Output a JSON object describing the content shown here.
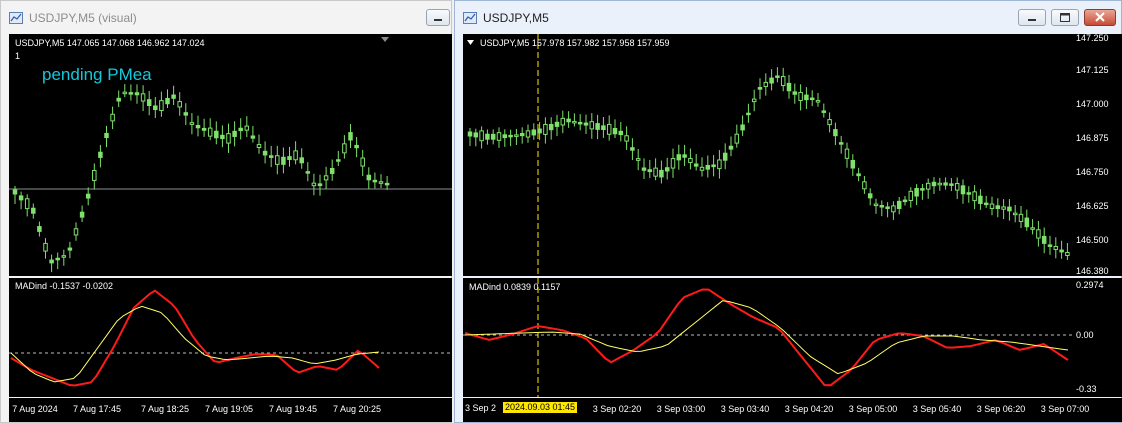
{
  "windows": {
    "left": {
      "title": "USDJPY,M5 (visual)",
      "chart_label": "USDJPY,M5  147.065 147.068 146.962 147.024",
      "sub_label": "1",
      "overlay_text": "pending PMea",
      "indicator_label": "MADind -0.1537 -0.0202",
      "time_axis": [
        "7 Aug 2024",
        "7 Aug 17:45",
        "7 Aug 18:25",
        "7 Aug 19:05",
        "7 Aug 19:45",
        "7 Aug 20:25"
      ]
    },
    "right": {
      "title": "USDJPY,M5",
      "chart_label": "USDJPY,M5  157.978 157.982 157.958 157.959",
      "indicator_label": "MADind 0.0839 0.1157",
      "price_axis": [
        "147.250",
        "147.125",
        "147.000",
        "146.875",
        "146.750",
        "146.625",
        "146.500",
        "146.380"
      ],
      "indicator_axis": [
        "0.2974",
        "0.00",
        "-0.33"
      ],
      "time_axis": [
        "3 Sep 2",
        "3 Sep 02:20",
        "3 Sep 03:00",
        "3 Sep 03:40",
        "3 Sep 04:20",
        "3 Sep 05:00",
        "3 Sep 05:40",
        "3 Sep 06:20",
        "3 Sep 07:00"
      ],
      "crosshair_time": "2024.09.03 01:45"
    }
  },
  "colors": {
    "candle": "#7ee16b",
    "indicator_fast": "#ff1a1a",
    "indicator_slow": "#ffff66",
    "crosshair": "#ffe800",
    "overlay_text": "#12c9dc"
  },
  "icons": {
    "window": "chart-window-icon",
    "min": "minimize-icon",
    "max": "maximize-icon",
    "close": "close-icon"
  }
}
